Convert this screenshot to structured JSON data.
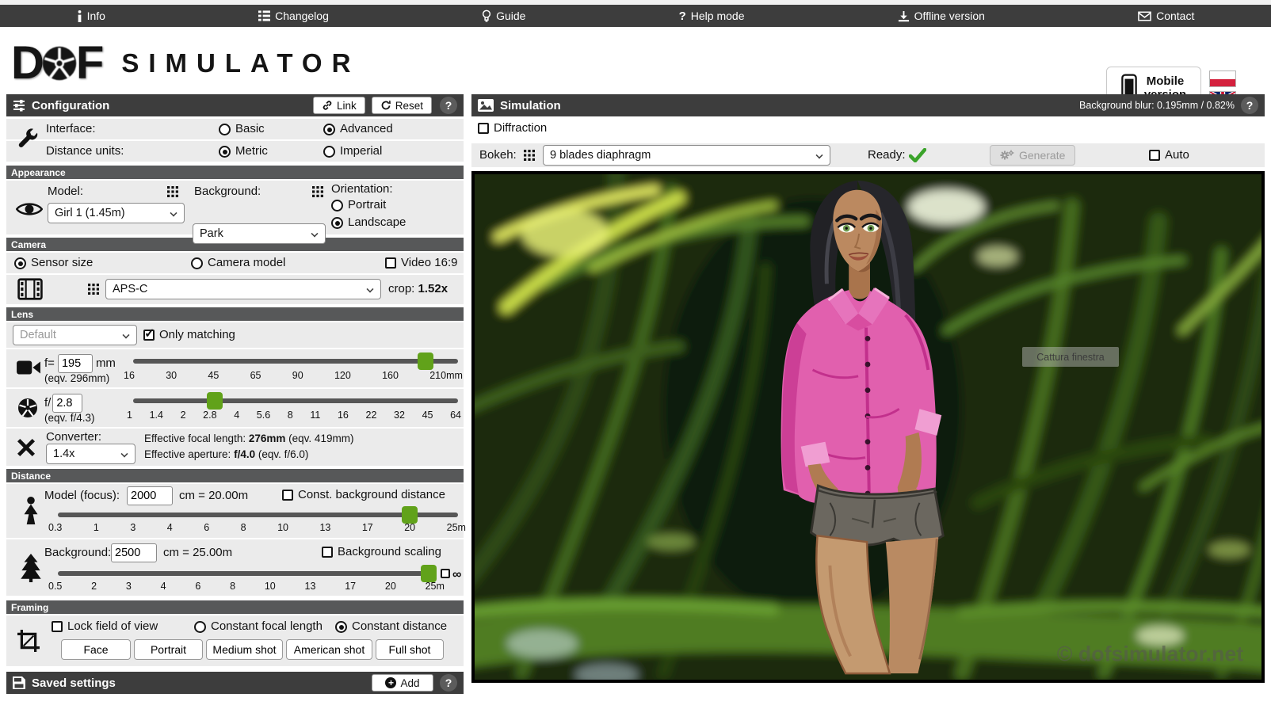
{
  "glyphs": {
    "question_mark": "?",
    "infinity": "∞",
    "checkmark": "✓",
    "plus": "+"
  },
  "colors": {
    "accent_green": "#61a21a",
    "panel_bar": "#3d3d3d",
    "section_bar": "#575859",
    "row_bg": "#ebebeb",
    "ready_green": "#3aa32a",
    "shirt_pink": "#e160ae"
  },
  "topbar": {
    "items": [
      {
        "label": "Info"
      },
      {
        "label": "Changelog"
      },
      {
        "label": "Guide"
      },
      {
        "label": "Help mode"
      },
      {
        "label": "Offline version"
      },
      {
        "label": "Contact"
      }
    ]
  },
  "logo": {
    "letter_d": "D",
    "letter_f": "F",
    "word": "SIMULATOR"
  },
  "mobile": {
    "line1": "Mobile",
    "line2": "version"
  },
  "config": {
    "title": "Configuration",
    "link_label": "Link",
    "reset_label": "Reset",
    "interface_label": "Interface:",
    "basic": "Basic",
    "advanced": "Advanced",
    "units_label": "Distance units:",
    "metric": "Metric",
    "imperial": "Imperial",
    "appearance": {
      "section": "Appearance",
      "model_label": "Model:",
      "model_value": "Girl 1 (1.45m)",
      "background_label": "Background:",
      "background_value": "Park",
      "orientation_label": "Orientation:",
      "portrait": "Portrait",
      "landscape": "Landscape"
    },
    "camera": {
      "section": "Camera",
      "sensor_size": "Sensor size",
      "camera_model": "Camera model",
      "video": "Video 16:9",
      "sensor_value": "APS-C",
      "crop_label": "crop:",
      "crop_value": "1.52x"
    },
    "lens": {
      "section": "Lens",
      "default_value": "Default",
      "only_matching": "Only matching",
      "focal": {
        "prefix": "f=",
        "value": "195",
        "unit": "mm",
        "eqv": "(eqv. 296mm)",
        "ticks": [
          "16",
          "30",
          "45",
          "65",
          "90",
          "120",
          "160",
          "210mm"
        ]
      },
      "aperture": {
        "prefix": "f/",
        "value": "2.8",
        "eqv": "(eqv. f/4.3)",
        "ticks": [
          "1",
          "1.4",
          "2",
          "2.8",
          "4",
          "5.6",
          "8",
          "11",
          "16",
          "22",
          "32",
          "45",
          "64"
        ]
      },
      "converter": {
        "label": "Converter:",
        "value": "1.4x",
        "efl_label": "Effective focal length:",
        "efl_value": "276mm",
        "efl_eqv": "(eqv. 419mm)",
        "efa_label": "Effective aperture:",
        "efa_value": "f/4.0",
        "efa_eqv": "(eqv. f/6.0)"
      }
    },
    "distance": {
      "section": "Distance",
      "model": {
        "label": "Model (focus):",
        "value": "2000",
        "suffix": "cm = 20.00m",
        "checkbox": "Const. background distance",
        "ticks": [
          "0.3",
          "1",
          "3",
          "4",
          "6",
          "8",
          "10",
          "13",
          "17",
          "20",
          "25m"
        ]
      },
      "background": {
        "label": "Background:",
        "value": "2500",
        "suffix": "cm = 25.00m",
        "checkbox": "Background scaling",
        "ticks": [
          "0.5",
          "2",
          "3",
          "4",
          "6",
          "8",
          "10",
          "13",
          "17",
          "20",
          "25m"
        ]
      }
    },
    "framing": {
      "section": "Framing",
      "lock": "Lock field of view",
      "const_focal": "Constant focal length",
      "const_dist": "Constant distance",
      "shots": [
        "Face",
        "Portrait",
        "Medium shot",
        "American shot",
        "Full shot"
      ]
    },
    "saved": {
      "title": "Saved settings",
      "add_label": "Add"
    }
  },
  "simulation": {
    "title": "Simulation",
    "blur_info": "Background blur: 0.195mm / 0.82%",
    "diffraction": "Diffraction",
    "bokeh_label": "Bokeh:",
    "bokeh_value": "9 blades diaphragm",
    "ready_label": "Ready:",
    "generate_label": "Generate",
    "auto_label": "Auto",
    "watermark": "© dofsimulator.net",
    "capture_overlay": "Cattura finestra"
  }
}
